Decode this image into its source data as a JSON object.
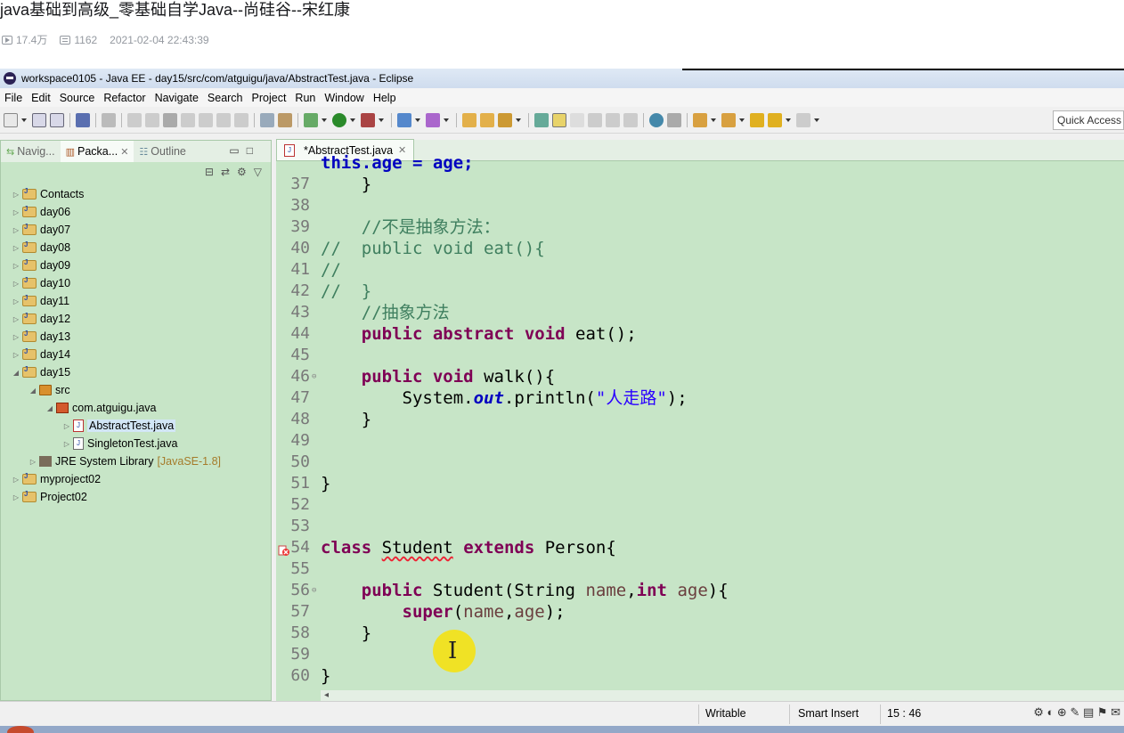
{
  "video": {
    "title": "java基础到高级_零基础自学Java--尚硅谷--宋红康",
    "views": "17.4万",
    "danmaku": "1162",
    "date": "2021-02-04 22:43:39"
  },
  "window": {
    "title": "workspace0105 - Java EE - day15/src/com/atguigu/java/AbstractTest.java - Eclipse"
  },
  "menu": [
    "File",
    "Edit",
    "Source",
    "Refactor",
    "Navigate",
    "Search",
    "Project",
    "Run",
    "Window",
    "Help"
  ],
  "toolbar": {
    "quick_access": "Quick Access"
  },
  "left_panel": {
    "tabs": [
      "Navig...",
      "Packa...",
      "Outline"
    ],
    "tree": [
      {
        "label": "Contacts",
        "level": 0,
        "type": "project"
      },
      {
        "label": "day06",
        "level": 0,
        "type": "project"
      },
      {
        "label": "day07",
        "level": 0,
        "type": "project"
      },
      {
        "label": "day08",
        "level": 0,
        "type": "project-closed"
      },
      {
        "label": "day09",
        "level": 0,
        "type": "project-closed"
      },
      {
        "label": "day10",
        "level": 0,
        "type": "project"
      },
      {
        "label": "day11",
        "level": 0,
        "type": "project"
      },
      {
        "label": "day12",
        "level": 0,
        "type": "project"
      },
      {
        "label": "day13",
        "level": 0,
        "type": "project"
      },
      {
        "label": "day14",
        "level": 0,
        "type": "project"
      },
      {
        "label": "day15",
        "level": 0,
        "type": "project-open"
      },
      {
        "label": "src",
        "level": 1,
        "type": "folder"
      },
      {
        "label": "com.atguigu.java",
        "level": 2,
        "type": "package"
      },
      {
        "label": "AbstractTest.java",
        "level": 3,
        "type": "file-selected"
      },
      {
        "label": "SingletonTest.java",
        "level": 3,
        "type": "file"
      },
      {
        "label": "JRE System Library",
        "level": 1,
        "type": "library",
        "tag": "[JavaSE-1.8]"
      },
      {
        "label": "myproject02",
        "level": 0,
        "type": "project"
      },
      {
        "label": "Project02",
        "level": 0,
        "type": "project"
      }
    ]
  },
  "editor": {
    "tab_label": "*AbstractTest.java",
    "first_line_partial": "this.age = age;",
    "lines": [
      {
        "n": "37",
        "html": "    }"
      },
      {
        "n": "38",
        "html": ""
      },
      {
        "n": "39",
        "html": "    <span class=\"cm\">//不是抽象方法：</span>"
      },
      {
        "n": "40",
        "html": "<span class=\"cm\">//  public void eat(){</span>"
      },
      {
        "n": "41",
        "html": "<span class=\"cm\">//</span>"
      },
      {
        "n": "42",
        "html": "<span class=\"cm\">//  }</span>"
      },
      {
        "n": "43",
        "html": "    <span class=\"cm\">//抽象方法</span>"
      },
      {
        "n": "44",
        "html": "    <span class=\"kw\">public</span> <span class=\"kw\">abstract</span> <span class=\"kw\">void</span> eat();"
      },
      {
        "n": "45",
        "html": ""
      },
      {
        "n": "46",
        "html": "    <span class=\"kw\">public</span> <span class=\"kw\">void</span> walk(){",
        "fold": true
      },
      {
        "n": "47",
        "html": "        System.<span class=\"fld\">out</span>.println(<span class=\"st\">\"人走路\"</span>);"
      },
      {
        "n": "48",
        "html": "    }"
      },
      {
        "n": "49",
        "html": ""
      },
      {
        "n": "50",
        "html": ""
      },
      {
        "n": "51",
        "html": "}"
      },
      {
        "n": "52",
        "html": ""
      },
      {
        "n": "53",
        "html": ""
      },
      {
        "n": "54",
        "html": "<span class=\"kw\">class</span> <span class=\"err\">Student</span> <span class=\"kw\">extends</span> Person{",
        "error": true
      },
      {
        "n": "55",
        "html": ""
      },
      {
        "n": "56",
        "html": "    <span class=\"kw\">public</span> Student(String <span class=\"param\">name</span>,<span class=\"kw\">int</span> <span class=\"param\">age</span>){",
        "fold": true
      },
      {
        "n": "57",
        "html": "        <span class=\"kw\">super</span>(<span class=\"param\">name</span>,<span class=\"param\">age</span>);"
      },
      {
        "n": "58",
        "html": "    }"
      },
      {
        "n": "59",
        "html": ""
      },
      {
        "n": "60",
        "html": "}"
      }
    ]
  },
  "status": {
    "writable": "Writable",
    "insert_mode": "Smart Insert",
    "position": "15 : 46"
  }
}
